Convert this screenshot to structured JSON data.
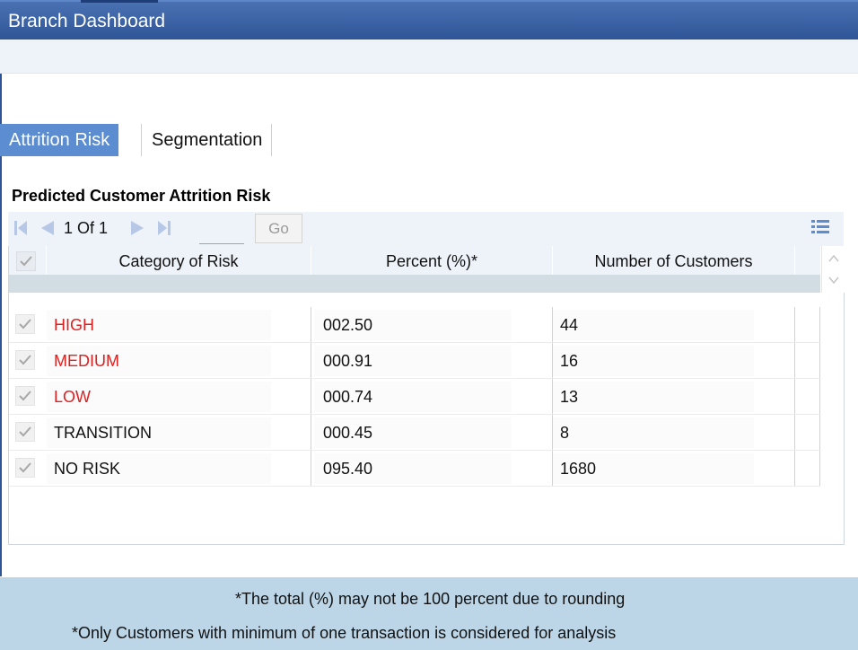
{
  "window": {
    "title": "Branch Dashboard"
  },
  "tabs": [
    {
      "label": "Attrition Risk",
      "active": true
    },
    {
      "label": "Segmentation",
      "active": false
    }
  ],
  "section": {
    "title": "Predicted Customer Attrition Risk"
  },
  "pager": {
    "page_text": "1 Of 1",
    "go_label": "Go",
    "page_value": ""
  },
  "grid": {
    "columns": [
      "Category of Risk",
      "Percent (%)*",
      "Number of Customers"
    ],
    "rows": [
      {
        "category": "HIGH",
        "percent": "002.50",
        "customers": "44",
        "category_color": "#e02020",
        "checked": true
      },
      {
        "category": "MEDIUM",
        "percent": "000.91",
        "customers": "16",
        "category_color": "#e02020",
        "checked": true
      },
      {
        "category": "LOW",
        "percent": "000.74",
        "customers": "13",
        "category_color": "#e02020",
        "checked": true
      },
      {
        "category": "TRANSITION",
        "percent": "000.45",
        "customers": "8",
        "category_color": "#111111",
        "checked": true
      },
      {
        "category": "NO RISK",
        "percent": "095.40",
        "customers": "1680",
        "category_color": "#111111",
        "checked": true
      }
    ]
  },
  "footer": {
    "note1": "*The total (%) may not be 100 percent due to rounding",
    "note2": "*Only Customers with minimum of one transaction is considered for analysis"
  },
  "colors": {
    "title_bar": "#2f5597",
    "active_tab": "#5b8dd0",
    "footer_bg": "#bcd6e8",
    "risk_red": "#e02020"
  },
  "icons": {
    "first_page": "first-page-icon",
    "prev_page": "previous-page-icon",
    "next_page": "next-page-icon",
    "last_page": "last-page-icon",
    "column_list": "list-icon",
    "checkbox": "checkmark-icon"
  }
}
